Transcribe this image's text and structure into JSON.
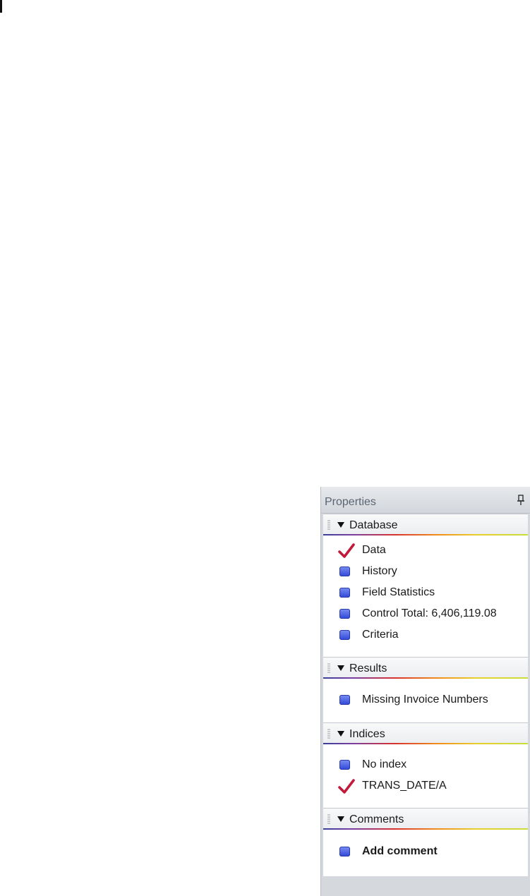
{
  "panel": {
    "title": "Properties"
  },
  "sections": [
    {
      "title": "Database",
      "items": [
        {
          "label": "Data",
          "icon": "check-icon"
        },
        {
          "label": "History",
          "icon": "blue-square-icon"
        },
        {
          "label": "Field Statistics",
          "icon": "blue-square-icon"
        },
        {
          "label": "Control Total: 6,406,119.08",
          "icon": "blue-square-icon"
        },
        {
          "label": "Criteria",
          "icon": "blue-square-icon"
        }
      ]
    },
    {
      "title": "Results",
      "items": [
        {
          "label": "Missing Invoice Numbers",
          "icon": "blue-square-icon"
        }
      ]
    },
    {
      "title": "Indices",
      "items": [
        {
          "label": "No index",
          "icon": "blue-square-icon"
        },
        {
          "label": "TRANS_DATE/A",
          "icon": "check-icon"
        }
      ]
    },
    {
      "title": "Comments",
      "items": [
        {
          "label": "Add comment",
          "icon": "blue-square-icon"
        }
      ]
    }
  ],
  "colors": {
    "bullet_blue": "#2f46d6",
    "check_red": "#c21a3a",
    "panel_bg": "#d5d8dd"
  }
}
